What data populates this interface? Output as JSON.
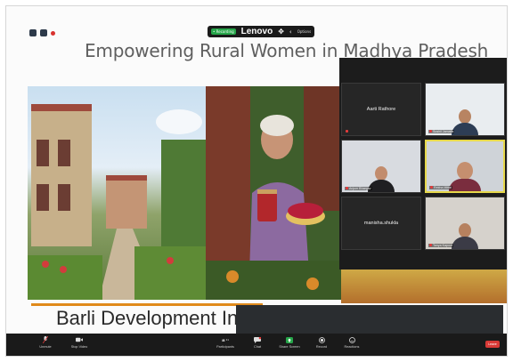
{
  "overlay": {
    "device_name": "Lenovo",
    "status_badge": "• Recording",
    "options_label": "Options"
  },
  "slide": {
    "title": "Empowering Rural Women in Madhya Pradesh",
    "caption": "Barli Development Ins"
  },
  "gallery": {
    "tiles": [
      {
        "name": "Aarti Rathore"
      },
      {
        "name": "Sushil Jamatia"
      },
      {
        "name": "Anjum Bhargav"
      },
      {
        "name": "Rekha Mittal"
      },
      {
        "name": "manisha.shukla"
      },
      {
        "name": "Tanya Kapoor"
      }
    ]
  },
  "toolbar": {
    "unmute": "Unmute",
    "stop_video": "Stop Video",
    "participants": "Participants",
    "participants_count": "31",
    "chat": "Chat",
    "share_screen": "Share Screen",
    "record": "Record",
    "reactions": "Reactions",
    "leave": "Leave"
  },
  "colors": {
    "toolbar_bg": "#1a1a1a",
    "leave_red": "#d93a37",
    "active_speaker": "#e7d84a",
    "share_green": "#26a64a",
    "caption_accent": "#e08a1b"
  }
}
